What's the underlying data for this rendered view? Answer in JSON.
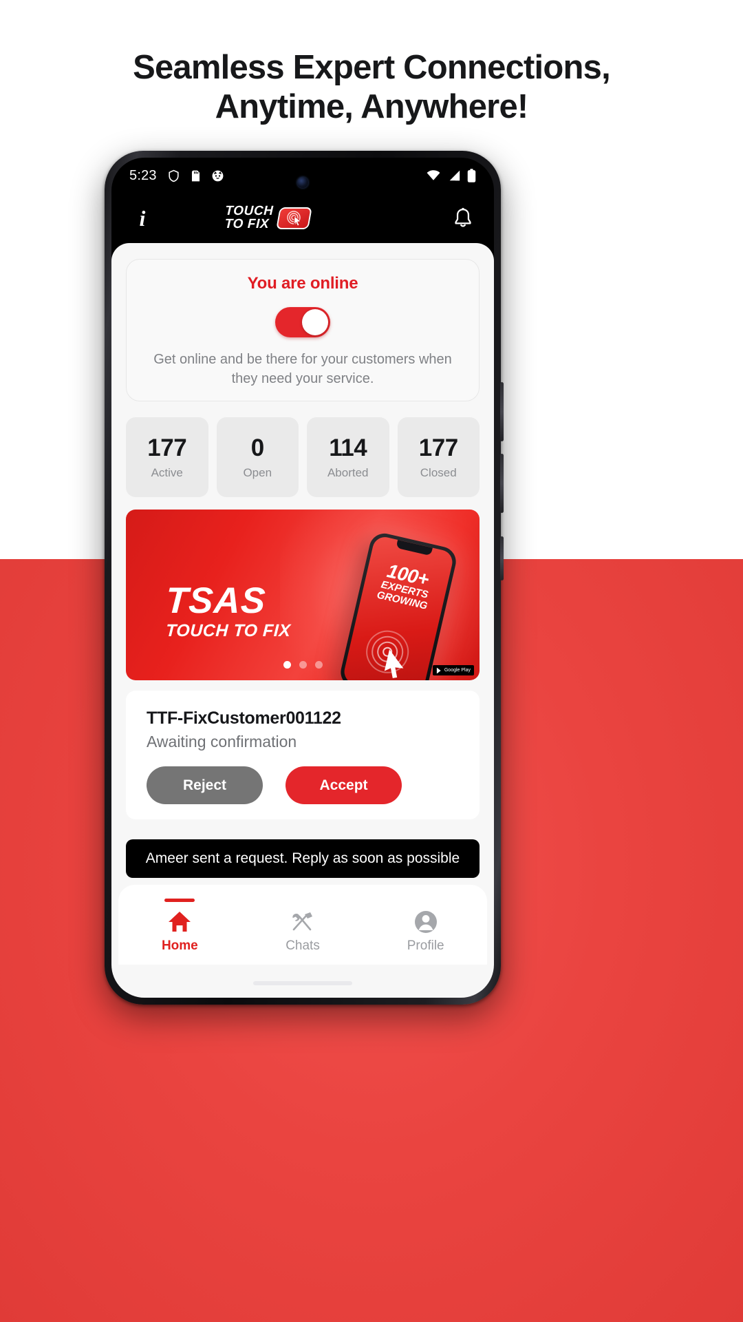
{
  "headline": {
    "line1": "Seamless Expert Connections,",
    "line2": "Anytime, Anywhere!"
  },
  "colors": {
    "brand_red": "#e4262b",
    "accent_red": "#e0211f",
    "dark": "#17181a",
    "muted": "#8b8d91",
    "sheet_bg": "#f7f7f7"
  },
  "status_bar": {
    "time": "5:23",
    "left_icons": [
      "shield-icon",
      "sd-card-icon",
      "cat-face-icon"
    ],
    "right_icons": [
      "wifi-icon",
      "signal-icon",
      "battery-icon"
    ]
  },
  "app_bar": {
    "info_icon": "info-icon",
    "logo_line1": "TOUCH",
    "logo_line2": "TO FIX",
    "logo_mark": "target-cursor-icon",
    "bell_icon": "bell-icon"
  },
  "online_card": {
    "title": "You are online",
    "toggle_state": "on",
    "description": "Get online and be there for your customers when they need your service."
  },
  "stats": [
    {
      "value": "177",
      "label": "Active"
    },
    {
      "value": "0",
      "label": "Open"
    },
    {
      "value": "114",
      "label": "Aborted"
    },
    {
      "value": "177",
      "label": "Closed"
    }
  ],
  "banner": {
    "brand": "TSAS",
    "tagline": "TOUCH TO FIX",
    "phone_line1": "100+",
    "phone_line2": "EXPERTS",
    "phone_line3": "GROWING",
    "badge_text": "Google Play",
    "dots": [
      {
        "active": true
      },
      {
        "active": false
      },
      {
        "active": false
      }
    ]
  },
  "request_card": {
    "id": "TTF-FixCustomer001122",
    "status": "Awaiting confirmation",
    "reject_label": "Reject",
    "accept_label": "Accept"
  },
  "toast": {
    "message": "Ameer sent a request. Reply as soon as possible"
  },
  "bottom_nav": [
    {
      "label": "Home",
      "icon": "home-icon",
      "active": true
    },
    {
      "label": "Chats",
      "icon": "tools-icon",
      "active": false
    },
    {
      "label": "Profile",
      "icon": "person-icon",
      "active": false
    }
  ]
}
